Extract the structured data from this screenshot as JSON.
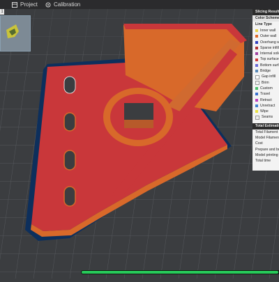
{
  "tabs": [
    {
      "label": "Project",
      "icon": "project-icon"
    },
    {
      "label": "Calibration",
      "icon": "calibration-icon"
    }
  ],
  "thumbnail_badge": "1",
  "slicing_panel": {
    "title": "Slicing Result",
    "color_scheme_label": "Color Scheme",
    "line_type_label": "Line Type",
    "line_types": [
      {
        "label": "Inner wall",
        "color": "#e8d24a"
      },
      {
        "label": "Outer wall",
        "color": "#e06a2a"
      },
      {
        "label": "Overhang wall",
        "color": "#3040c0"
      },
      {
        "label": "Sparse infill",
        "color": "#b03030"
      },
      {
        "label": "Internal solid infill",
        "color": "#a040a0"
      },
      {
        "label": "Top surface",
        "color": "#d03a3a"
      },
      {
        "label": "Bottom surface",
        "color": "#6a6ad8"
      },
      {
        "label": "Bridge",
        "color": "#5a8ab8"
      },
      {
        "label": "Gap infill",
        "color": "#ffffff"
      },
      {
        "label": "Brim",
        "color": "#f3f3f3"
      },
      {
        "label": "Custom",
        "color": "#4cbf6a"
      },
      {
        "label": "Travel",
        "color": "#3a70d0"
      },
      {
        "label": "Retract",
        "color": "#c040c0"
      },
      {
        "label": "Unretract",
        "color": "#4080d0"
      },
      {
        "label": "Wipe",
        "color": "#e8e040"
      },
      {
        "label": "Seams",
        "color": "#f0f0f0"
      }
    ],
    "estimation_title": "Total Estimation",
    "estimation_rows": [
      "Total Filament",
      "Model Filament",
      "Cost",
      "Prepare and build",
      "Model printing",
      "Total time"
    ]
  },
  "progress": {
    "fraction": 0.98,
    "color": "#27c95a"
  },
  "colors": {
    "background": "#3b3d40",
    "grid": "#55585c",
    "top_surface": "#c9373a",
    "wall": "#d8692a",
    "brim": "#0d2f5c"
  }
}
